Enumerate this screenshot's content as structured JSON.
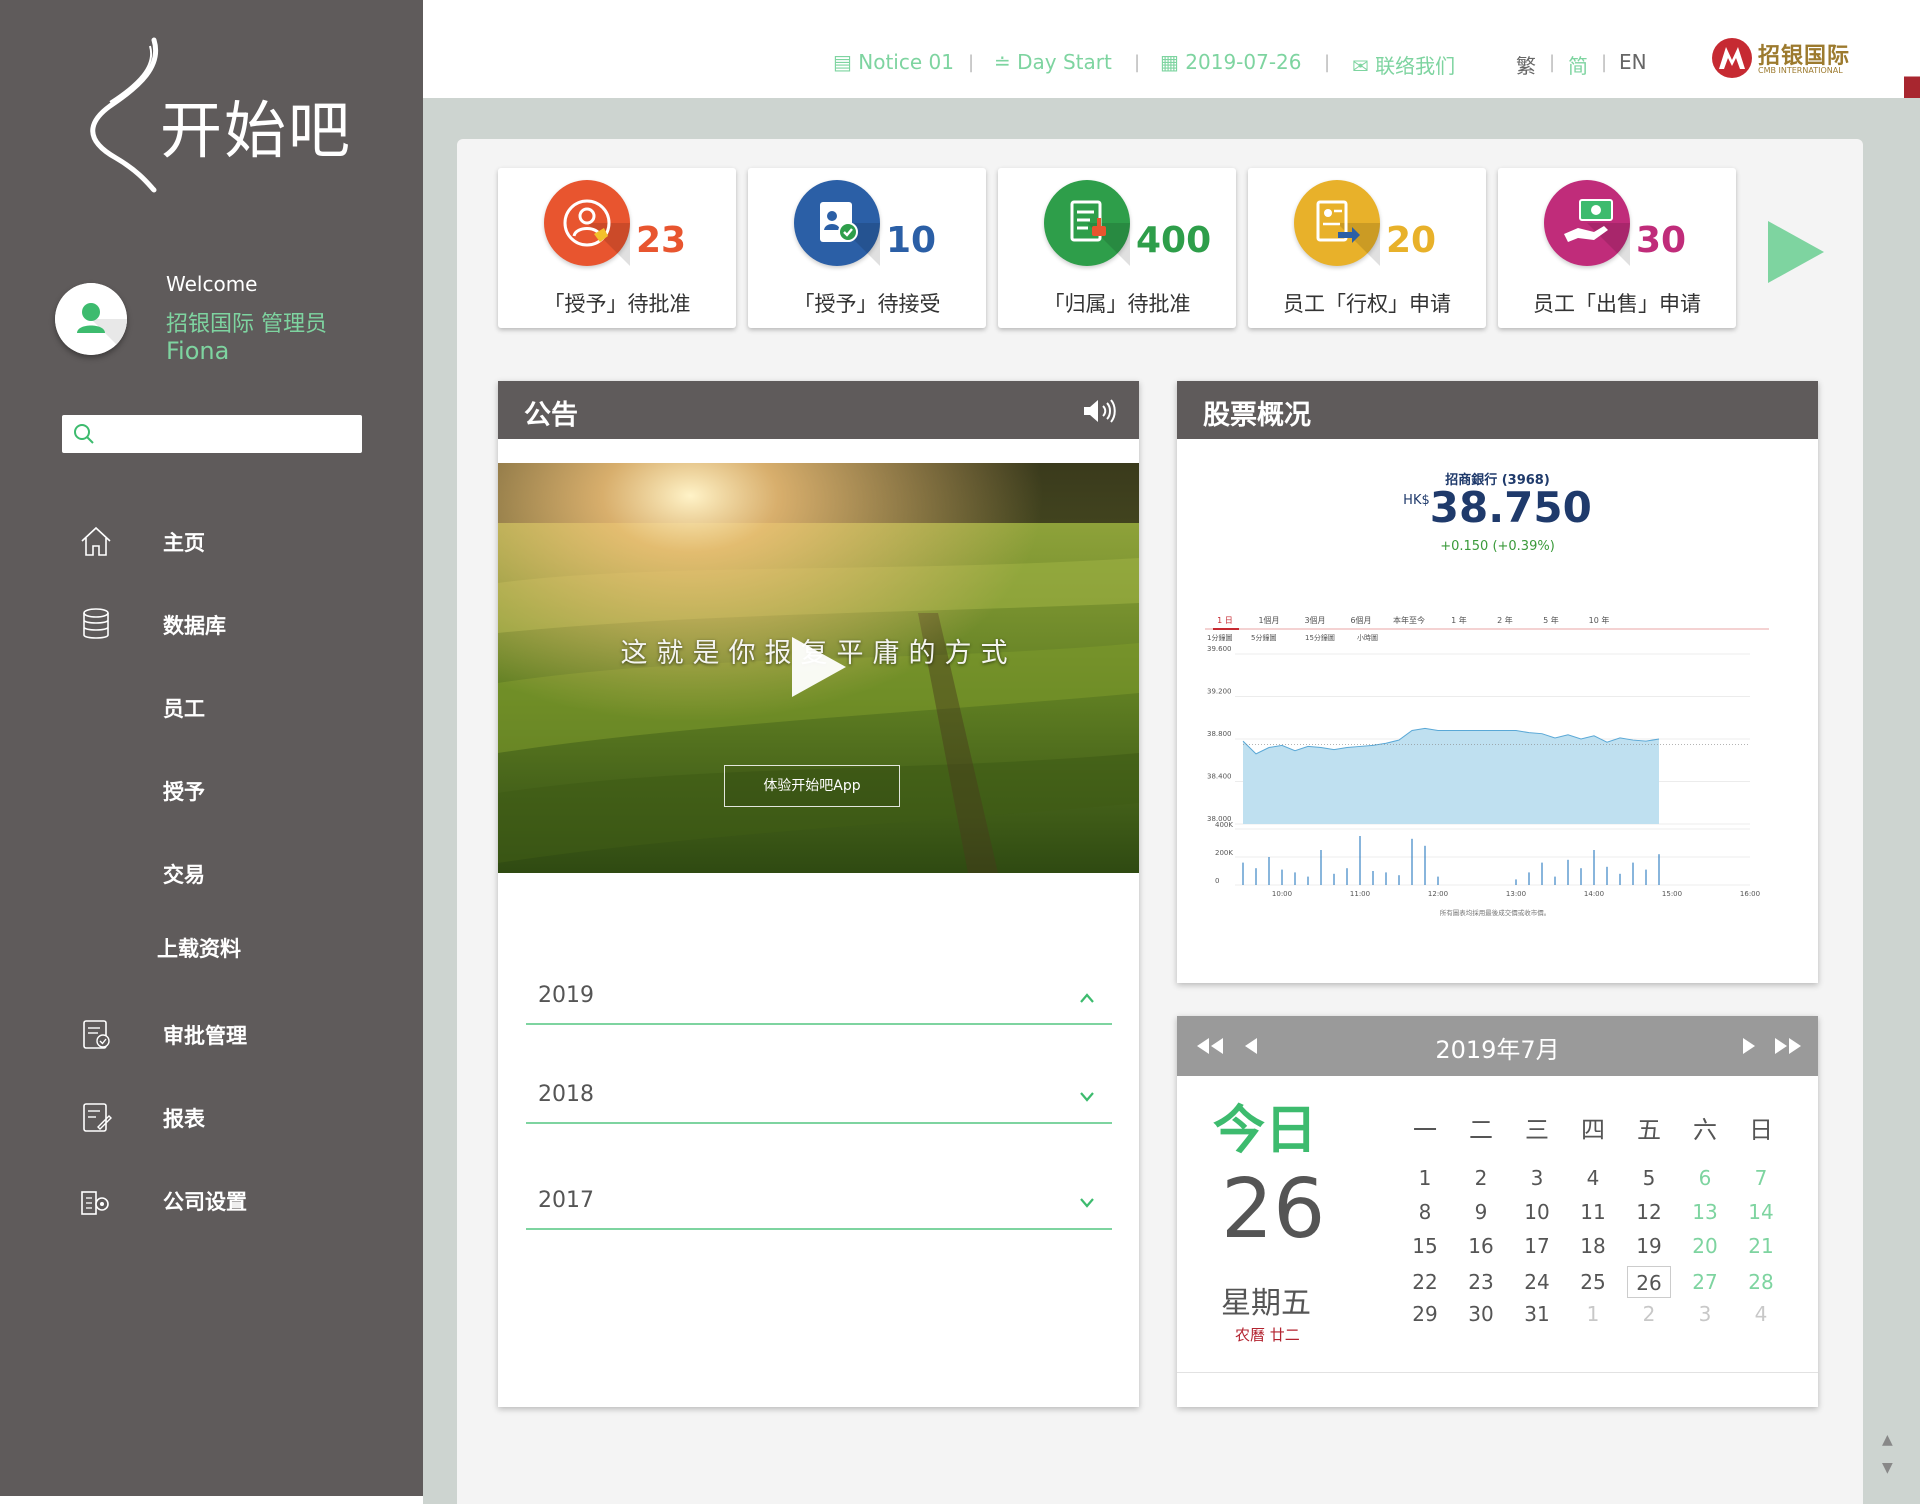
{
  "brand": {
    "logo_text": "开始吧"
  },
  "user": {
    "welcome": "Welcome",
    "company_role": "招银国际 管理员",
    "name": "Fiona"
  },
  "search": {
    "placeholder": ""
  },
  "nav": [
    {
      "label": "主页",
      "icon": "home-icon"
    },
    {
      "label": "数据库",
      "icon": "database-icon"
    },
    {
      "label": "员工",
      "icon": ""
    },
    {
      "label": "授予",
      "icon": ""
    },
    {
      "label": "交易",
      "icon": ""
    },
    {
      "label": "上载资料",
      "icon": ""
    },
    {
      "label": "审批管理",
      "icon": "approval-icon"
    },
    {
      "label": "报表",
      "icon": "report-icon"
    },
    {
      "label": "公司设置",
      "icon": "company-settings-icon"
    }
  ],
  "topbar": {
    "notice": "Notice 01",
    "day_start": "Day Start",
    "date": "2019-07-26",
    "contact": "联络我们",
    "lang_trad": "繁",
    "lang_simp": "简",
    "lang_en": "EN",
    "partner_logo_cn": "招银国际",
    "partner_logo_en": "CMB INTERNATIONAL"
  },
  "stats": [
    {
      "count": "23",
      "label": "「授予」待批准",
      "color": "#e8552f",
      "icon": "grant-person-icon"
    },
    {
      "count": "10",
      "label": "「授予」待接受",
      "color": "#2b5fa6",
      "icon": "accept-document-icon"
    },
    {
      "count": "400",
      "label": "「归属」待批准",
      "color": "#2e9e4a",
      "icon": "vesting-document-icon"
    },
    {
      "count": "20",
      "label": "员工「行权」申请",
      "color": "#e8b12a",
      "icon": "exercise-transfer-icon"
    },
    {
      "count": "30",
      "label": "员工「出售」申请",
      "color": "#c02c7a",
      "icon": "sell-money-icon"
    }
  ],
  "notice_panel": {
    "title": "公告",
    "video_caption": "这就是你报复平庸的方式",
    "video_button": "体验开始吧App",
    "years": [
      {
        "label": "2019",
        "expanded": true
      },
      {
        "label": "2018",
        "expanded": false
      },
      {
        "label": "2017",
        "expanded": false
      }
    ]
  },
  "stock_panel": {
    "title": "股票概况",
    "name": "招商銀行 (3968)",
    "currency": "HK$",
    "price": "38.750",
    "change": "+0.150 (+0.39%)",
    "range_tabs": [
      "1 日",
      "1個月",
      "3個月",
      "6個月",
      "本年至今",
      "1 年",
      "2 年",
      "5 年",
      "10 年"
    ],
    "interval_tabs": [
      "1分鐘圖",
      "5分鐘圖",
      "15分鐘圖",
      "小時圖"
    ],
    "footnote": "所有圖表均採用最後成交價或收市價。"
  },
  "chart_data": {
    "type": "area",
    "title": "",
    "xlabel": "",
    "ylabel": "",
    "x_ticks": [
      "10:00",
      "11:00",
      "12:00",
      "13:00",
      "14:00",
      "15:00",
      "16:00"
    ],
    "y_ticks": [
      "39.600",
      "39.200",
      "38.800",
      "38.400",
      "38.000"
    ],
    "ylim": [
      38.0,
      39.6
    ],
    "previous_close": 38.75,
    "series": [
      {
        "name": "",
        "x": [
          "09:30",
          "09:40",
          "09:50",
          "10:00",
          "10:10",
          "10:20",
          "10:30",
          "10:40",
          "10:50",
          "11:00",
          "11:10",
          "11:20",
          "11:30",
          "11:40",
          "11:50",
          "12:00",
          "13:00",
          "13:10",
          "13:20",
          "13:30",
          "13:40",
          "13:50",
          "14:00",
          "14:10",
          "14:20",
          "14:30",
          "14:40",
          "14:50"
        ],
        "values": [
          38.78,
          38.66,
          38.72,
          38.74,
          38.69,
          38.73,
          38.72,
          38.7,
          38.72,
          38.73,
          38.74,
          38.76,
          38.79,
          38.88,
          38.9,
          38.88,
          38.88,
          38.86,
          38.85,
          38.81,
          38.84,
          38.8,
          38.83,
          38.77,
          38.81,
          38.79,
          38.78,
          38.8
        ]
      }
    ],
    "volume": {
      "y_ticks": [
        "400K",
        "200K",
        "0"
      ],
      "x": [
        "09:30",
        "09:40",
        "09:50",
        "10:00",
        "10:10",
        "10:20",
        "10:30",
        "10:40",
        "10:50",
        "11:00",
        "11:10",
        "11:20",
        "11:30",
        "11:40",
        "11:50",
        "12:00",
        "13:00",
        "13:10",
        "13:20",
        "13:30",
        "13:40",
        "13:50",
        "14:00",
        "14:10",
        "14:20",
        "14:30",
        "14:40",
        "14:50"
      ],
      "values": [
        160,
        120,
        200,
        110,
        90,
        60,
        250,
        80,
        120,
        350,
        100,
        90,
        70,
        330,
        280,
        60,
        40,
        90,
        160,
        60,
        180,
        120,
        250,
        130,
        80,
        160,
        110,
        220
      ]
    }
  },
  "calendar": {
    "title": "2019年7月",
    "today_label": "今日",
    "today_day": "26",
    "today_weekday": "星期五",
    "today_lunar": "农曆 廿二",
    "weekdays": [
      "一",
      "二",
      "三",
      "四",
      "五",
      "六",
      "日"
    ],
    "weeks": [
      [
        "1",
        "2",
        "3",
        "4",
        "5",
        "6",
        "7"
      ],
      [
        "8",
        "9",
        "10",
        "11",
        "12",
        "13",
        "14"
      ],
      [
        "15",
        "16",
        "17",
        "18",
        "19",
        "20",
        "21"
      ],
      [
        "22",
        "23",
        "24",
        "25",
        "26",
        "27",
        "28"
      ],
      [
        "29",
        "30",
        "31",
        "1",
        "2",
        "3",
        "4"
      ]
    ],
    "selected": "26",
    "weekend_color": "#7ed4a0",
    "other_month_color": "#c8c8c8"
  }
}
